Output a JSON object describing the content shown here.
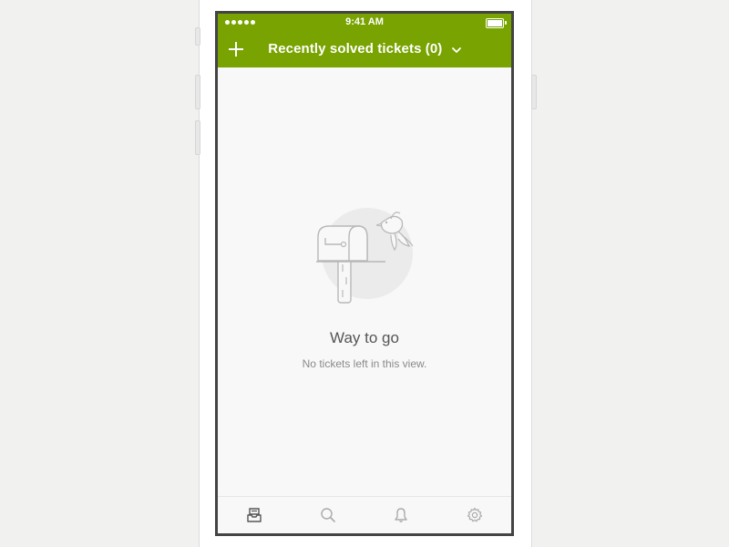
{
  "status_bar": {
    "time": "9:41 AM"
  },
  "nav": {
    "title": "Recently solved tickets (0)",
    "accent_color": "#78a300"
  },
  "empty_state": {
    "title": "Way to go",
    "subtitle": "No tickets left in this view."
  },
  "tabs": [
    {
      "icon": "inbox-icon",
      "active": true
    },
    {
      "icon": "search-icon",
      "active": false
    },
    {
      "icon": "bell-icon",
      "active": false
    },
    {
      "icon": "gear-icon",
      "active": false
    }
  ]
}
